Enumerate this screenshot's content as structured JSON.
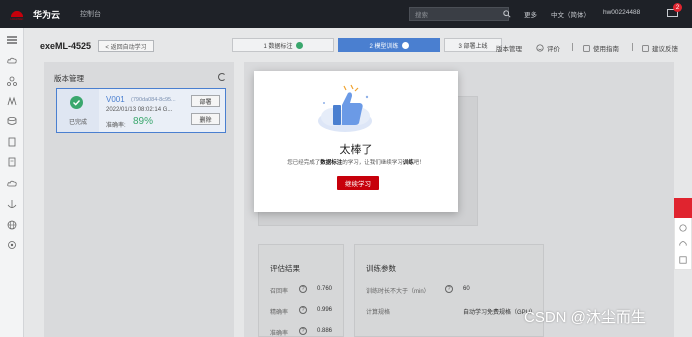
{
  "topbar": {
    "logo_text": "HUAWEI",
    "brand": "华为云",
    "console": "控制台",
    "search_placeholder": "搜索",
    "more": "更多",
    "language": "中文（简体）",
    "username": "hw00224488",
    "mail_badge": "2"
  },
  "header": {
    "title": "exeML-4525",
    "back_label": "< 返回自动学习",
    "steps": [
      {
        "label": "1 数据标注"
      },
      {
        "label": "2 模型训练"
      },
      {
        "label": "3 部署上线"
      }
    ],
    "actions": {
      "version_manage": "版本管理",
      "rate": "评价",
      "guide": "使用指南",
      "feedback": "建议反馈"
    }
  },
  "version_panel": {
    "title": "版本管理",
    "version": {
      "name": "V001",
      "id": "(790da084-8c95...",
      "date": "2022/01/13 08:02:14 G...",
      "status": "已完成",
      "accuracy_label": "准确率:",
      "accuracy": "89%",
      "deploy_btn": "部署",
      "delete_btn": "删除"
    }
  },
  "evaluation": {
    "title": "评估结果",
    "metrics": [
      {
        "label": "召回率",
        "value": "0.760"
      },
      {
        "label": "精确率",
        "value": "0.996"
      },
      {
        "label": "准确率",
        "value": "0.886"
      }
    ]
  },
  "training": {
    "title": "训练参数",
    "params": [
      {
        "label": "训练时长不大于（min）",
        "value": "60"
      },
      {
        "label": "计算规格",
        "value": "自动学习免费规格（GPU）"
      }
    ]
  },
  "modal": {
    "title": "太棒了",
    "desc_prefix": "您已经完成了",
    "desc_bold1": "数据标注",
    "desc_mid": "的学习，让我们继续学习",
    "desc_bold2": "训练",
    "desc_suffix": "吧！",
    "button": "继续学习"
  },
  "watermark": "CSDN @沐尘而生",
  "colors": {
    "accent": "#4a7fd0",
    "success": "#3aa76d",
    "brand_red": "#c7000b"
  }
}
